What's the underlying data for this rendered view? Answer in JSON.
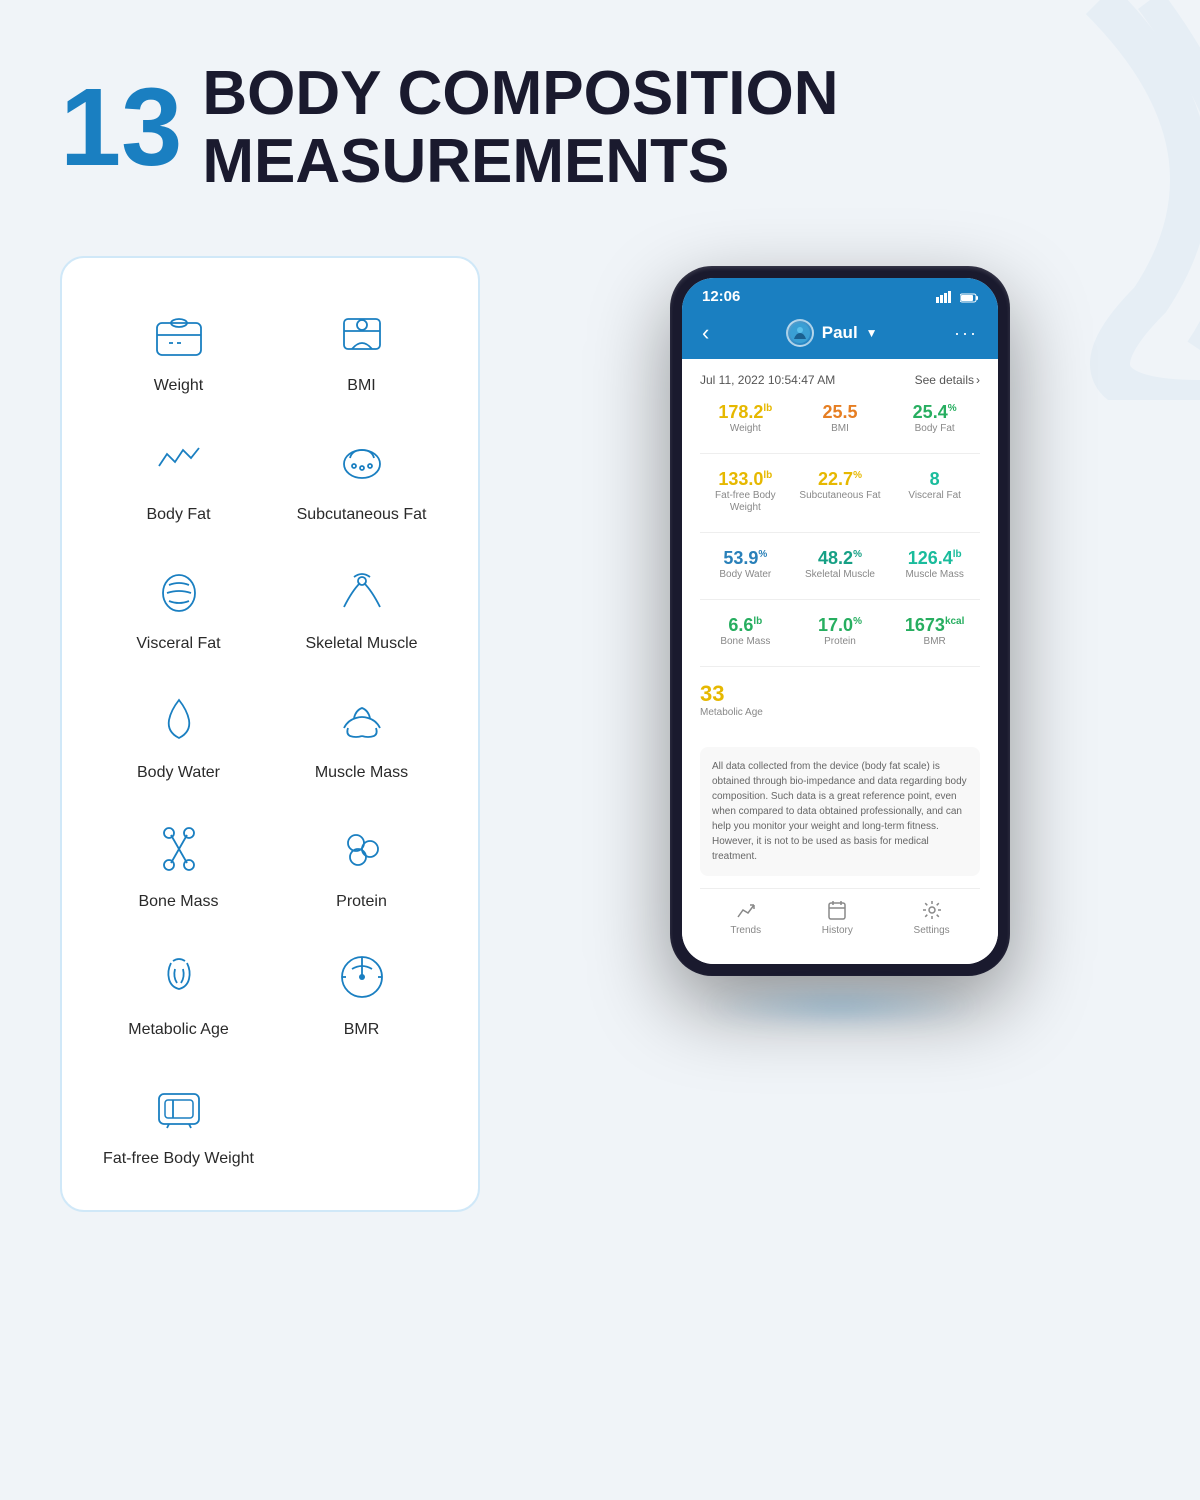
{
  "header": {
    "number": "13",
    "line1": "BODY COMPOSITION",
    "line2": "MEASUREMENTS"
  },
  "measurements": [
    {
      "id": "weight",
      "label": "Weight",
      "icon": "scale"
    },
    {
      "id": "bmi",
      "label": "BMI",
      "icon": "bmi"
    },
    {
      "id": "body-fat",
      "label": "Body Fat",
      "icon": "heartbeat"
    },
    {
      "id": "subcutaneous-fat",
      "label": "Subcutaneous\nFat",
      "icon": "subcutaneous"
    },
    {
      "id": "visceral-fat",
      "label": "Visceral Fat",
      "icon": "visceral"
    },
    {
      "id": "skeletal-muscle",
      "label": "Skeletal\nMuscle",
      "icon": "muscle-outline"
    },
    {
      "id": "body-water",
      "label": "Body Water",
      "icon": "droplet"
    },
    {
      "id": "muscle-mass",
      "label": "Muscle\nMass",
      "icon": "arm"
    },
    {
      "id": "bone-mass",
      "label": "Bone Mass",
      "icon": "bone"
    },
    {
      "id": "protein",
      "label": "Protein",
      "icon": "molecule"
    },
    {
      "id": "metabolic-age",
      "label": "Metabolic\nAge",
      "icon": "dna"
    },
    {
      "id": "bmr",
      "label": "BMR",
      "icon": "gauge"
    },
    {
      "id": "fat-free",
      "label": "Fat-free\nBody Weight",
      "icon": "scale-simple"
    }
  ],
  "phone": {
    "time": "12:06",
    "user": "Paul",
    "date": "Jul 11, 2022 10:54:47 AM",
    "see_details": "See details",
    "rows": [
      [
        {
          "value": "178.2",
          "unit": "lb",
          "label": "Weight",
          "color": "yellow"
        },
        {
          "value": "25.5",
          "unit": "",
          "label": "BMI",
          "color": "orange"
        },
        {
          "value": "25.4",
          "unit": "%",
          "label": "Body Fat",
          "color": "green-light"
        }
      ],
      [
        {
          "value": "133.0",
          "unit": "lb",
          "label": "Fat-free Body Weight",
          "color": "yellow"
        },
        {
          "value": "22.7",
          "unit": "%",
          "label": "Subcutaneous\nFat",
          "color": "yellow"
        },
        {
          "value": "8",
          "unit": "",
          "label": "Visceral Fat",
          "color": "green"
        }
      ],
      [
        {
          "value": "53.9",
          "unit": "%",
          "label": "Body Water",
          "color": "blue"
        },
        {
          "value": "48.2",
          "unit": "%",
          "label": "Skeletal Muscle",
          "color": "teal"
        },
        {
          "value": "126.4",
          "unit": "lb",
          "label": "Muscle Mass",
          "color": "green"
        }
      ],
      [
        {
          "value": "6.6",
          "unit": "lb",
          "label": "Bone Mass",
          "color": "green-light"
        },
        {
          "value": "17.0",
          "unit": "%",
          "label": "Protein",
          "color": "green-light"
        },
        {
          "value": "1673",
          "unit": "kcal",
          "label": "BMR",
          "color": "green-light"
        }
      ]
    ],
    "metabolic_age": {
      "value": "33",
      "unit": "",
      "label": "Metabolic Age",
      "color": "yellow"
    },
    "disclaimer": "All data collected from the device (body fat scale) is obtained through bio-impedance and data regarding body composition. Such data is a great reference point, even when compared to data obtained professionally, and can help you monitor your weight and long-term fitness. However, it is not to be used as basis for medical treatment.",
    "nav_items": [
      {
        "label": "Trends",
        "icon": "trends"
      },
      {
        "label": "History",
        "icon": "history"
      },
      {
        "label": "Settings",
        "icon": "settings"
      }
    ]
  }
}
